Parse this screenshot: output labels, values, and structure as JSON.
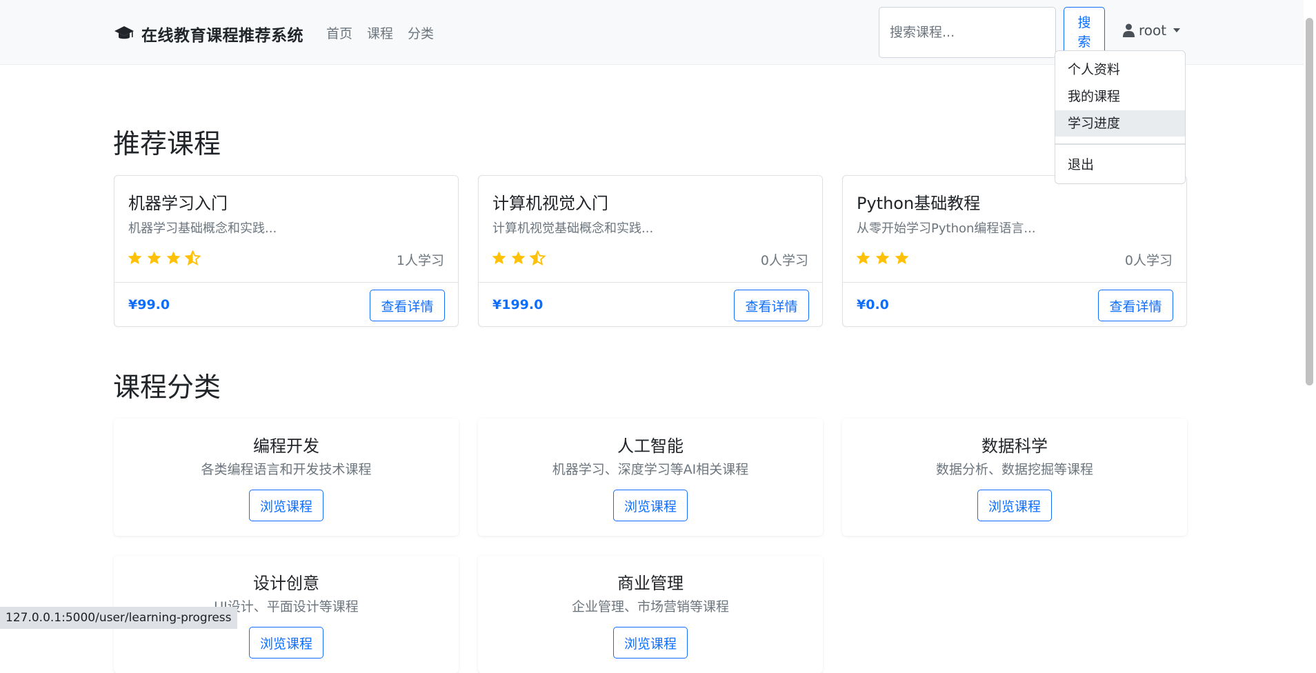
{
  "navbar": {
    "brand": "在线教育课程推荐系统",
    "links": [
      "首页",
      "课程",
      "分类"
    ],
    "search_placeholder": "搜索课程...",
    "search_button": "搜索",
    "user": "root"
  },
  "dropdown": {
    "items": [
      "个人资料",
      "我的课程",
      "学习进度",
      "退出"
    ],
    "active_index": 2
  },
  "recommended": {
    "title": "推荐课程",
    "courses": [
      {
        "title": "机器学习入门",
        "desc": "机器学习基础概念和实践...",
        "rating": 3.5,
        "students": "1人学习",
        "price": "¥99.0",
        "button": "查看详情"
      },
      {
        "title": "计算机视觉入门",
        "desc": "计算机视觉基础概念和实践...",
        "rating": 2.5,
        "students": "0人学习",
        "price": "¥199.0",
        "button": "查看详情"
      },
      {
        "title": "Python基础教程",
        "desc": "从零开始学习Python编程语言...",
        "rating": 3,
        "students": "0人学习",
        "price": "¥0.0",
        "button": "查看详情"
      }
    ]
  },
  "categories": {
    "title": "课程分类",
    "items": [
      {
        "title": "编程开发",
        "desc": "各类编程语言和开发技术课程",
        "button": "浏览课程"
      },
      {
        "title": "人工智能",
        "desc": "机器学习、深度学习等AI相关课程",
        "button": "浏览课程"
      },
      {
        "title": "数据科学",
        "desc": "数据分析、数据挖掘等课程",
        "button": "浏览课程"
      },
      {
        "title": "设计创意",
        "desc": "UI设计、平面设计等课程",
        "button": "浏览课程"
      },
      {
        "title": "商业管理",
        "desc": "企业管理、市场营销等课程",
        "button": "浏览课程"
      }
    ]
  },
  "status_bar": {
    "url": "127.0.0.1:5000/user/learning-progress"
  },
  "colors": {
    "primary": "#0d6efd",
    "star": "#ffc107",
    "muted": "#6c757d"
  }
}
